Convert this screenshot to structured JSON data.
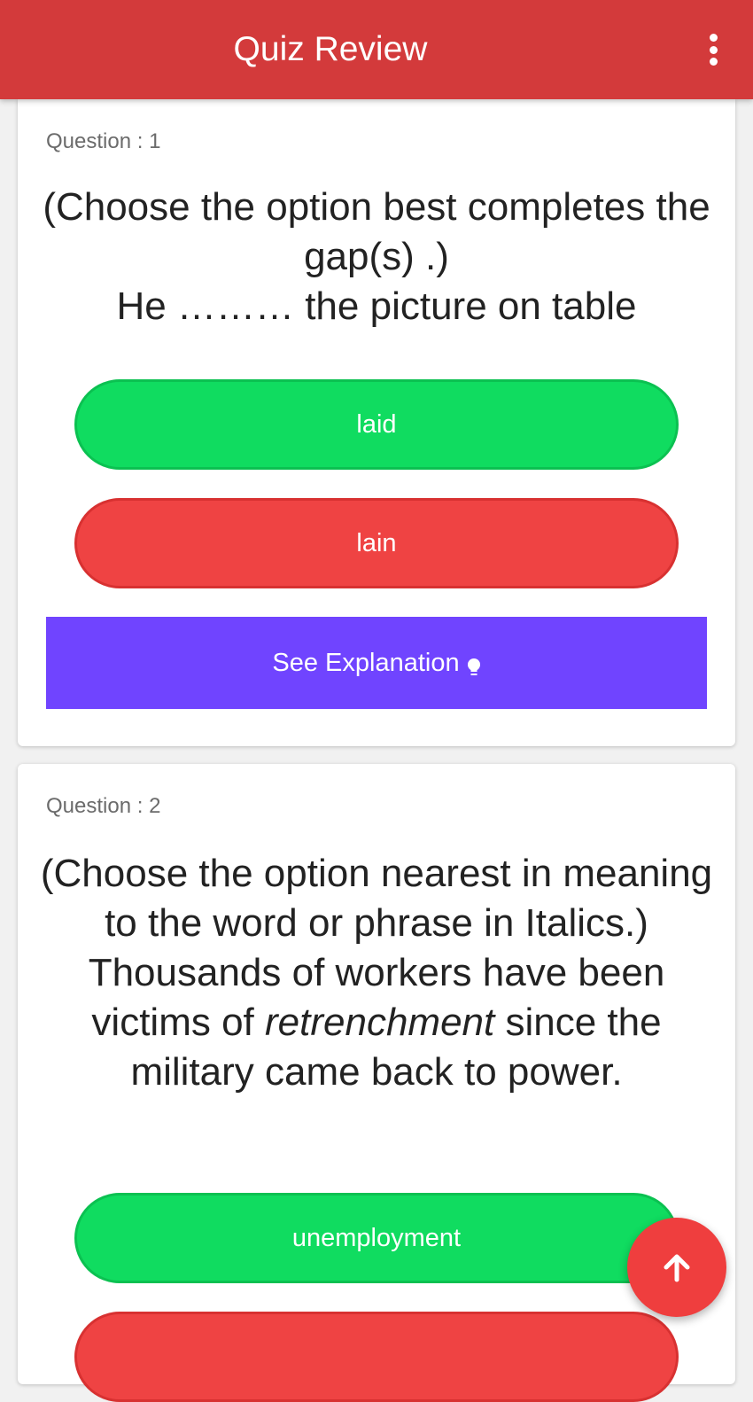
{
  "appbar": {
    "title": "Quiz Review",
    "menu_icon": "more-vertical-icon",
    "color": "#d33a3b"
  },
  "questions": [
    {
      "label": "Question : 1",
      "instruction": "(Choose the option best completes the gap(s) .)",
      "text": "He ……… the picture on table",
      "options": [
        {
          "label": "laid",
          "status": "correct"
        },
        {
          "label": "lain",
          "status": "wrong"
        }
      ],
      "explanation_button": "See Explanation",
      "explanation_icon": "lightbulb-icon"
    },
    {
      "label": "Question : 2",
      "instruction": "(Choose the option nearest in meaning to the word or phrase in Italics.)",
      "text_before": "Thousands of workers have been victims of ",
      "text_italic": "retrenchment",
      "text_after": " since the military came back to power.",
      "options": [
        {
          "label": "unemployment",
          "status": "correct"
        },
        {
          "label": "",
          "status": "wrong"
        }
      ]
    }
  ],
  "fab": {
    "icon": "arrow-up-icon",
    "color": "#ef3e3e"
  },
  "colors": {
    "correct": "#10dc60",
    "wrong": "#ef4343",
    "explanation": "#7044ff"
  }
}
